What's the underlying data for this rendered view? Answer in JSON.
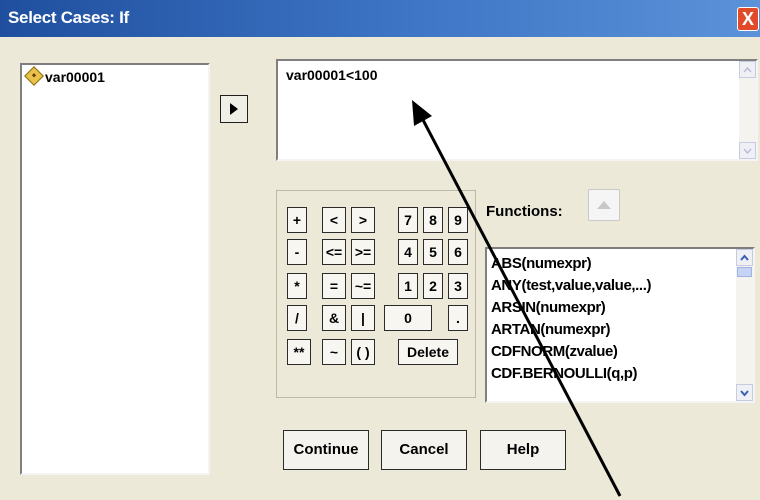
{
  "window": {
    "title": "Select Cases: If",
    "close_label": "X"
  },
  "variables": {
    "items": [
      {
        "label": "var00001"
      }
    ]
  },
  "expression": {
    "value": "var00001<100"
  },
  "keypad": {
    "keys": [
      "+",
      "<",
      ">",
      "7",
      "8",
      "9",
      "-",
      "<=",
      ">=",
      "4",
      "5",
      "6",
      "*",
      "=",
      "~=",
      "1",
      "2",
      "3",
      "/",
      "&",
      "|",
      "0",
      ".",
      "**",
      "~",
      "( )",
      "Delete"
    ]
  },
  "functions": {
    "label": "Functions:",
    "items": [
      "ABS(numexpr)",
      "ANY(test,value,value,...)",
      "ARSIN(numexpr)",
      "ARTAN(numexpr)",
      "CDFNORM(zvalue)",
      "CDF.BERNOULLI(q,p)"
    ]
  },
  "buttons": {
    "continue": "Continue",
    "cancel": "Cancel",
    "help": "Help"
  },
  "colors": {
    "titlebar": "#2a5aa9",
    "close": "#e14b2a",
    "dialog_bg": "#ece9d8",
    "arrow": "#000000"
  }
}
